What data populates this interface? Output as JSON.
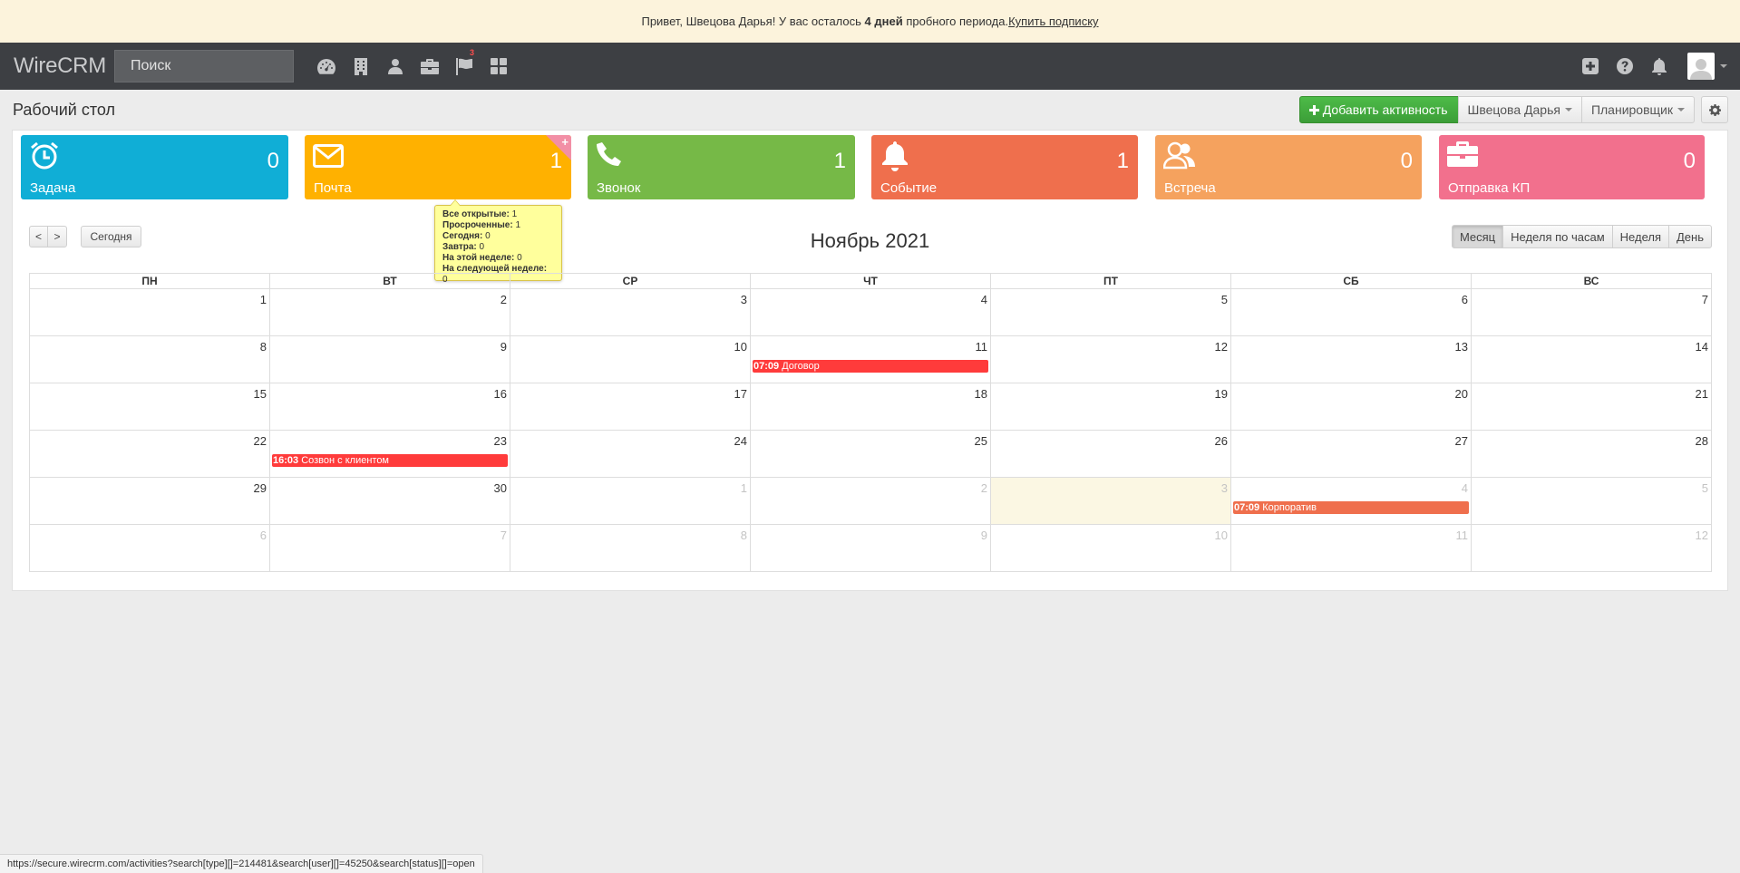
{
  "banner": {
    "prefix": "Привет, Швецова Дарья! У вас осталось ",
    "days": "4 дней",
    "suffix": " пробного периода. ",
    "link": "Купить подписку"
  },
  "topnav": {
    "brand": "WireCRM",
    "search_placeholder": "Поиск",
    "flag_badge": "3"
  },
  "header": {
    "title": "Рабочий стол",
    "add_activity": "Добавить активность",
    "user_filter": "Швецова Дарья",
    "planner": "Планировщик"
  },
  "tiles": [
    {
      "label": "Задача",
      "count": "0",
      "color": "#10aed6",
      "icon": "alarm-clock-icon"
    },
    {
      "label": "Почта",
      "count": "1",
      "color": "#ffb100",
      "icon": "envelope-icon"
    },
    {
      "label": "Звонок",
      "count": "1",
      "color": "#76b947",
      "icon": "phone-icon"
    },
    {
      "label": "Событие",
      "count": "1",
      "color": "#ef6f4d",
      "icon": "bell-icon"
    },
    {
      "label": "Встреча",
      "count": "0",
      "color": "#f5a25e",
      "icon": "users-icon"
    },
    {
      "label": "Отправка КП",
      "count": "0",
      "color": "#f2708d",
      "icon": "briefcase-icon"
    }
  ],
  "tooltip": {
    "rows": [
      {
        "label": "Все открытые:",
        "value": "1"
      },
      {
        "label": "Просроченные:",
        "value": "1"
      },
      {
        "label": "Сегодня:",
        "value": "0"
      },
      {
        "label": "Завтра:",
        "value": "0"
      },
      {
        "label": "На этой неделе:",
        "value": "0"
      },
      {
        "label": "На следующей неделе:",
        "value": "0"
      }
    ]
  },
  "calendar": {
    "prev": "<",
    "next": ">",
    "today": "Сегодня",
    "title": "Ноябрь 2021",
    "views": [
      "Месяц",
      "Неделя по часам",
      "Неделя",
      "День"
    ],
    "active_view": "Месяц",
    "weekdays": [
      "ПН",
      "ВТ",
      "СР",
      "ЧТ",
      "ПТ",
      "СБ",
      "ВС"
    ],
    "weeks": [
      [
        "1",
        "2",
        "3",
        "4",
        "5",
        "6",
        "7"
      ],
      [
        "8",
        "9",
        "10",
        "11",
        "12",
        "13",
        "14"
      ],
      [
        "15",
        "16",
        "17",
        "18",
        "19",
        "20",
        "21"
      ],
      [
        "22",
        "23",
        "24",
        "25",
        "26",
        "27",
        "28"
      ],
      [
        "29",
        "30",
        "1",
        "2",
        "3",
        "4",
        "5"
      ],
      [
        "6",
        "7",
        "8",
        "9",
        "10",
        "11",
        "12"
      ]
    ],
    "today_cell": {
      "week": 4,
      "day": 4
    },
    "events": [
      {
        "week": 1,
        "day": 3,
        "time": "07:09",
        "title": "Договор",
        "color": "#ff3b3b"
      },
      {
        "week": 3,
        "day": 1,
        "time": "16:03",
        "title": "Созвон с клиентом",
        "color": "#ff3b3b"
      },
      {
        "week": 4,
        "day": 5,
        "time": "07:09",
        "title": "Корпоратив",
        "color": "#ef6f4d"
      }
    ]
  },
  "statusbar": {
    "url": "https://secure.wirecrm.com/activities?search[type][]=214481&search[user][]=45250&search[status][]=open"
  }
}
